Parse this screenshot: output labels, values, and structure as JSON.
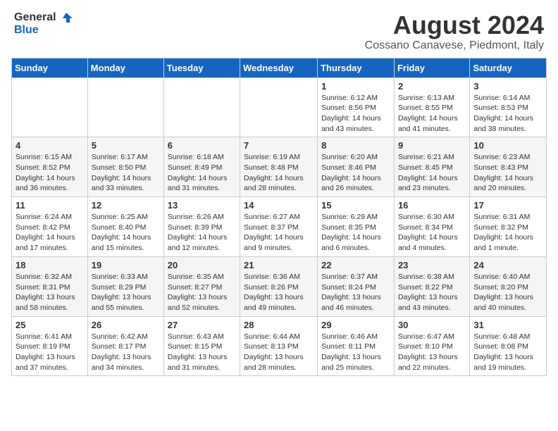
{
  "header": {
    "logo_general": "General",
    "logo_blue": "Blue",
    "month_title": "August 2024",
    "location": "Cossano Canavese, Piedmont, Italy"
  },
  "days_of_week": [
    "Sunday",
    "Monday",
    "Tuesday",
    "Wednesday",
    "Thursday",
    "Friday",
    "Saturday"
  ],
  "weeks": [
    [
      {
        "day": "",
        "info": ""
      },
      {
        "day": "",
        "info": ""
      },
      {
        "day": "",
        "info": ""
      },
      {
        "day": "",
        "info": ""
      },
      {
        "day": "1",
        "info": "Sunrise: 6:12 AM\nSunset: 8:56 PM\nDaylight: 14 hours and 43 minutes."
      },
      {
        "day": "2",
        "info": "Sunrise: 6:13 AM\nSunset: 8:55 PM\nDaylight: 14 hours and 41 minutes."
      },
      {
        "day": "3",
        "info": "Sunrise: 6:14 AM\nSunset: 8:53 PM\nDaylight: 14 hours and 38 minutes."
      }
    ],
    [
      {
        "day": "4",
        "info": "Sunrise: 6:15 AM\nSunset: 8:52 PM\nDaylight: 14 hours and 36 minutes."
      },
      {
        "day": "5",
        "info": "Sunrise: 6:17 AM\nSunset: 8:50 PM\nDaylight: 14 hours and 33 minutes."
      },
      {
        "day": "6",
        "info": "Sunrise: 6:18 AM\nSunset: 8:49 PM\nDaylight: 14 hours and 31 minutes."
      },
      {
        "day": "7",
        "info": "Sunrise: 6:19 AM\nSunset: 8:48 PM\nDaylight: 14 hours and 28 minutes."
      },
      {
        "day": "8",
        "info": "Sunrise: 6:20 AM\nSunset: 8:46 PM\nDaylight: 14 hours and 26 minutes."
      },
      {
        "day": "9",
        "info": "Sunrise: 6:21 AM\nSunset: 8:45 PM\nDaylight: 14 hours and 23 minutes."
      },
      {
        "day": "10",
        "info": "Sunrise: 6:23 AM\nSunset: 8:43 PM\nDaylight: 14 hours and 20 minutes."
      }
    ],
    [
      {
        "day": "11",
        "info": "Sunrise: 6:24 AM\nSunset: 8:42 PM\nDaylight: 14 hours and 17 minutes."
      },
      {
        "day": "12",
        "info": "Sunrise: 6:25 AM\nSunset: 8:40 PM\nDaylight: 14 hours and 15 minutes."
      },
      {
        "day": "13",
        "info": "Sunrise: 6:26 AM\nSunset: 8:39 PM\nDaylight: 14 hours and 12 minutes."
      },
      {
        "day": "14",
        "info": "Sunrise: 6:27 AM\nSunset: 8:37 PM\nDaylight: 14 hours and 9 minutes."
      },
      {
        "day": "15",
        "info": "Sunrise: 6:29 AM\nSunset: 8:35 PM\nDaylight: 14 hours and 6 minutes."
      },
      {
        "day": "16",
        "info": "Sunrise: 6:30 AM\nSunset: 8:34 PM\nDaylight: 14 hours and 4 minutes."
      },
      {
        "day": "17",
        "info": "Sunrise: 6:31 AM\nSunset: 8:32 PM\nDaylight: 14 hours and 1 minute."
      }
    ],
    [
      {
        "day": "18",
        "info": "Sunrise: 6:32 AM\nSunset: 8:31 PM\nDaylight: 13 hours and 58 minutes."
      },
      {
        "day": "19",
        "info": "Sunrise: 6:33 AM\nSunset: 8:29 PM\nDaylight: 13 hours and 55 minutes."
      },
      {
        "day": "20",
        "info": "Sunrise: 6:35 AM\nSunset: 8:27 PM\nDaylight: 13 hours and 52 minutes."
      },
      {
        "day": "21",
        "info": "Sunrise: 6:36 AM\nSunset: 8:26 PM\nDaylight: 13 hours and 49 minutes."
      },
      {
        "day": "22",
        "info": "Sunrise: 6:37 AM\nSunset: 8:24 PM\nDaylight: 13 hours and 46 minutes."
      },
      {
        "day": "23",
        "info": "Sunrise: 6:38 AM\nSunset: 8:22 PM\nDaylight: 13 hours and 43 minutes."
      },
      {
        "day": "24",
        "info": "Sunrise: 6:40 AM\nSunset: 8:20 PM\nDaylight: 13 hours and 40 minutes."
      }
    ],
    [
      {
        "day": "25",
        "info": "Sunrise: 6:41 AM\nSunset: 8:19 PM\nDaylight: 13 hours and 37 minutes."
      },
      {
        "day": "26",
        "info": "Sunrise: 6:42 AM\nSunset: 8:17 PM\nDaylight: 13 hours and 34 minutes."
      },
      {
        "day": "27",
        "info": "Sunrise: 6:43 AM\nSunset: 8:15 PM\nDaylight: 13 hours and 31 minutes."
      },
      {
        "day": "28",
        "info": "Sunrise: 6:44 AM\nSunset: 8:13 PM\nDaylight: 13 hours and 28 minutes."
      },
      {
        "day": "29",
        "info": "Sunrise: 6:46 AM\nSunset: 8:11 PM\nDaylight: 13 hours and 25 minutes."
      },
      {
        "day": "30",
        "info": "Sunrise: 6:47 AM\nSunset: 8:10 PM\nDaylight: 13 hours and 22 minutes."
      },
      {
        "day": "31",
        "info": "Sunrise: 6:48 AM\nSunset: 8:08 PM\nDaylight: 13 hours and 19 minutes."
      }
    ]
  ]
}
